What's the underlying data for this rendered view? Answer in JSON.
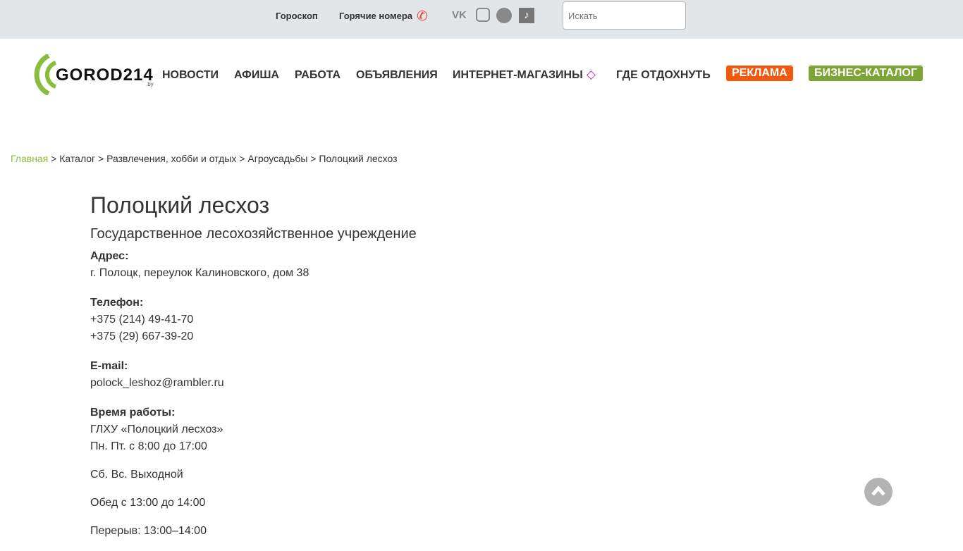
{
  "topbar": {
    "horoscope": "Гороскоп",
    "hot_numbers": "Горячие номера",
    "search_placeholder": "Искать",
    "social": [
      "vk-icon",
      "instagram-icon",
      "telegram-icon",
      "tiktok-icon"
    ]
  },
  "logo": {
    "text": "GOROD214",
    "suffix": ".by",
    "color": "#8bbd3c"
  },
  "nav": {
    "items": [
      "НОВОСТИ",
      "АФИША",
      "РАБОТА",
      "ОБЪЯВЛЕНИЯ",
      "ИНТЕРНЕТ-МАГАЗИНЫ",
      "ГДЕ ОТДОХНУТЬ"
    ],
    "ads": "РЕКЛАМА",
    "catalog": "БИЗНЕС-КАТАЛОГ",
    "ads_color": "#f05a0e",
    "catalog_color": "#7ba534"
  },
  "breadcrumb": [
    "Главная",
    "Каталог",
    "Развлечения, хобби и отдых",
    "Агроусадьбы",
    "Полоцкий лесхоз"
  ],
  "page": {
    "title": "Полоцкий лесхоз",
    "subtitle": "Государственное лесохозяйственное учреждение",
    "address_label": "Адрес:",
    "address": "г. Полоцк, переулок Калиновского, дом 38",
    "phone_label": "Телефон:",
    "phones": [
      "+375 (214) 49-41-70",
      "+375 (29) 667-39-20"
    ],
    "email_label": "E-mail:",
    "email": "polock_leshoz@rambler.ru",
    "hours_label": "Время работы:",
    "hours": [
      "ГЛХУ «Полоцкий лесхоз»",
      "Пн. Пт. с 8:00 до 17:00"
    ],
    "extra": [
      "Сб. Вс. Выходной",
      "Обед с 13:00 до 14:00",
      "Перерыв: 13:00–14:00"
    ]
  }
}
